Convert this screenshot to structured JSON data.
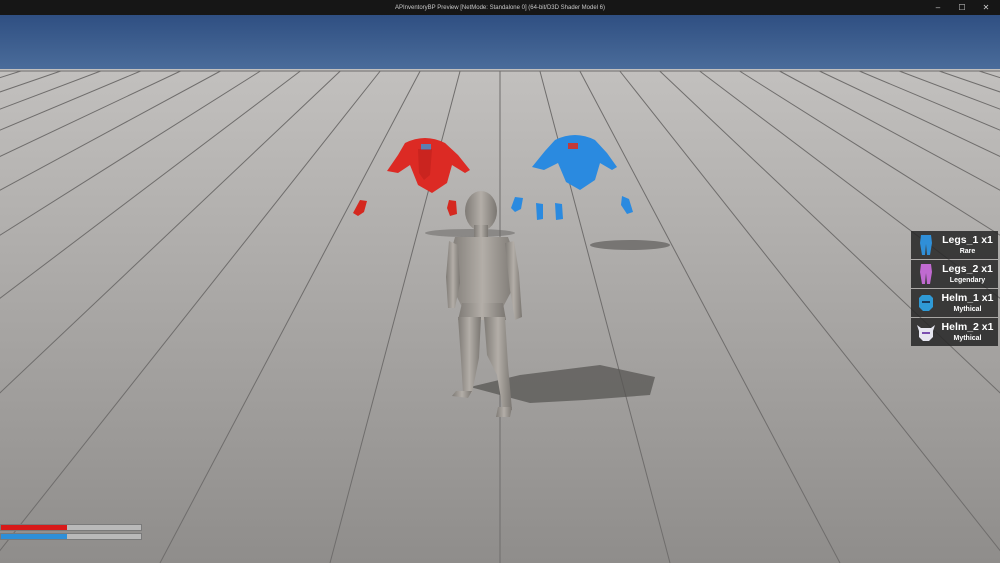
{
  "window": {
    "title": "APInventoryBP Preview [NetMode: Standalone 0]  (64-bit/D3D Shader Model 6)",
    "controls": {
      "minimize": "–",
      "maximize": "☐",
      "close": "✕"
    }
  },
  "inventory": {
    "items": [
      {
        "name": "Legs_1 x1",
        "rarity": "Rare",
        "icon": "legs-icon",
        "color": "#2f8fd8"
      },
      {
        "name": "Legs_2 x1",
        "rarity": "Legendary",
        "icon": "legs-icon",
        "color": "#c06ad0"
      },
      {
        "name": "Helm_1 x1",
        "rarity": "Mythical",
        "icon": "helm-icon",
        "color": "#2f9ad6"
      },
      {
        "name": "Helm_2 x1",
        "rarity": "Mythical",
        "icon": "helm-icon",
        "color": "#e6e6f0"
      }
    ]
  },
  "status_bars": {
    "health": {
      "fraction": 0.47,
      "color": "#d81a1a"
    },
    "mana": {
      "fraction": 0.47,
      "color": "#2e8fd8"
    }
  },
  "colors": {
    "sky": "#3d5f8f",
    "floor": "#a6a4a2",
    "grid": "#6f6d6c",
    "red_armor": "#dc2a24",
    "blue_armor": "#2a8ae0",
    "mannequin": "#a29e98"
  }
}
